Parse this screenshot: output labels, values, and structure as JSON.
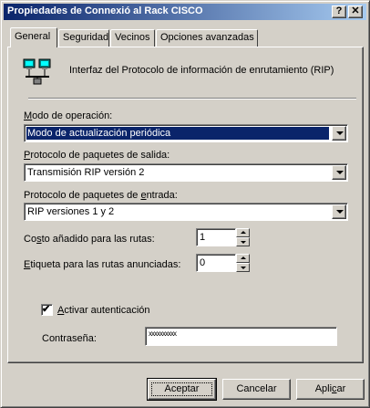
{
  "window": {
    "title": "Propiedades de Connexió al Rack CISCO",
    "help_glyph": "?",
    "close_glyph": "✕"
  },
  "tabs": [
    {
      "label": "General",
      "active": true
    },
    {
      "label": "Seguridad",
      "active": false
    },
    {
      "label": "Vecinos",
      "active": false
    },
    {
      "label": "Opciones avanzadas",
      "active": false
    }
  ],
  "header": {
    "icon": "network-computers-icon",
    "description": "Interfaz del Protocolo de información de enrutamiento (RIP)"
  },
  "fields": {
    "operation_mode": {
      "label_accel": "M",
      "label_rest": "odo de operación:",
      "value": "Modo de actualización periódica"
    },
    "outgoing": {
      "label_accel": "P",
      "label_rest": "rotocolo de paquetes de salida:",
      "value": "Transmisión RIP versión 2"
    },
    "incoming": {
      "label_pre": "Protocolo de paquetes de ",
      "label_accel": "e",
      "label_rest": "ntrada:",
      "value": "RIP versiones 1 y 2"
    },
    "route_cost": {
      "label_pre": "Co",
      "label_accel": "s",
      "label_rest": "to añadido para las rutas:",
      "value": "1"
    },
    "route_tag": {
      "label_accel": "E",
      "label_rest": "tiqueta para las rutas anunciadas:",
      "value": "0"
    },
    "auth": {
      "checked": true,
      "check_glyph": "✔",
      "label_accel": "A",
      "label_rest": "ctivar autenticación"
    },
    "password": {
      "label": "Contraseña:",
      "value": "xxxxxxxxxx"
    }
  },
  "buttons": {
    "accept": "Aceptar",
    "cancel": "Cancelar",
    "apply_pre": "Apli",
    "apply_accel": "c",
    "apply_rest": "ar"
  },
  "colors": {
    "title_start": "#0a246a",
    "title_end": "#a6caf0",
    "face": "#d4d0c8",
    "selection": "#0a246a"
  }
}
